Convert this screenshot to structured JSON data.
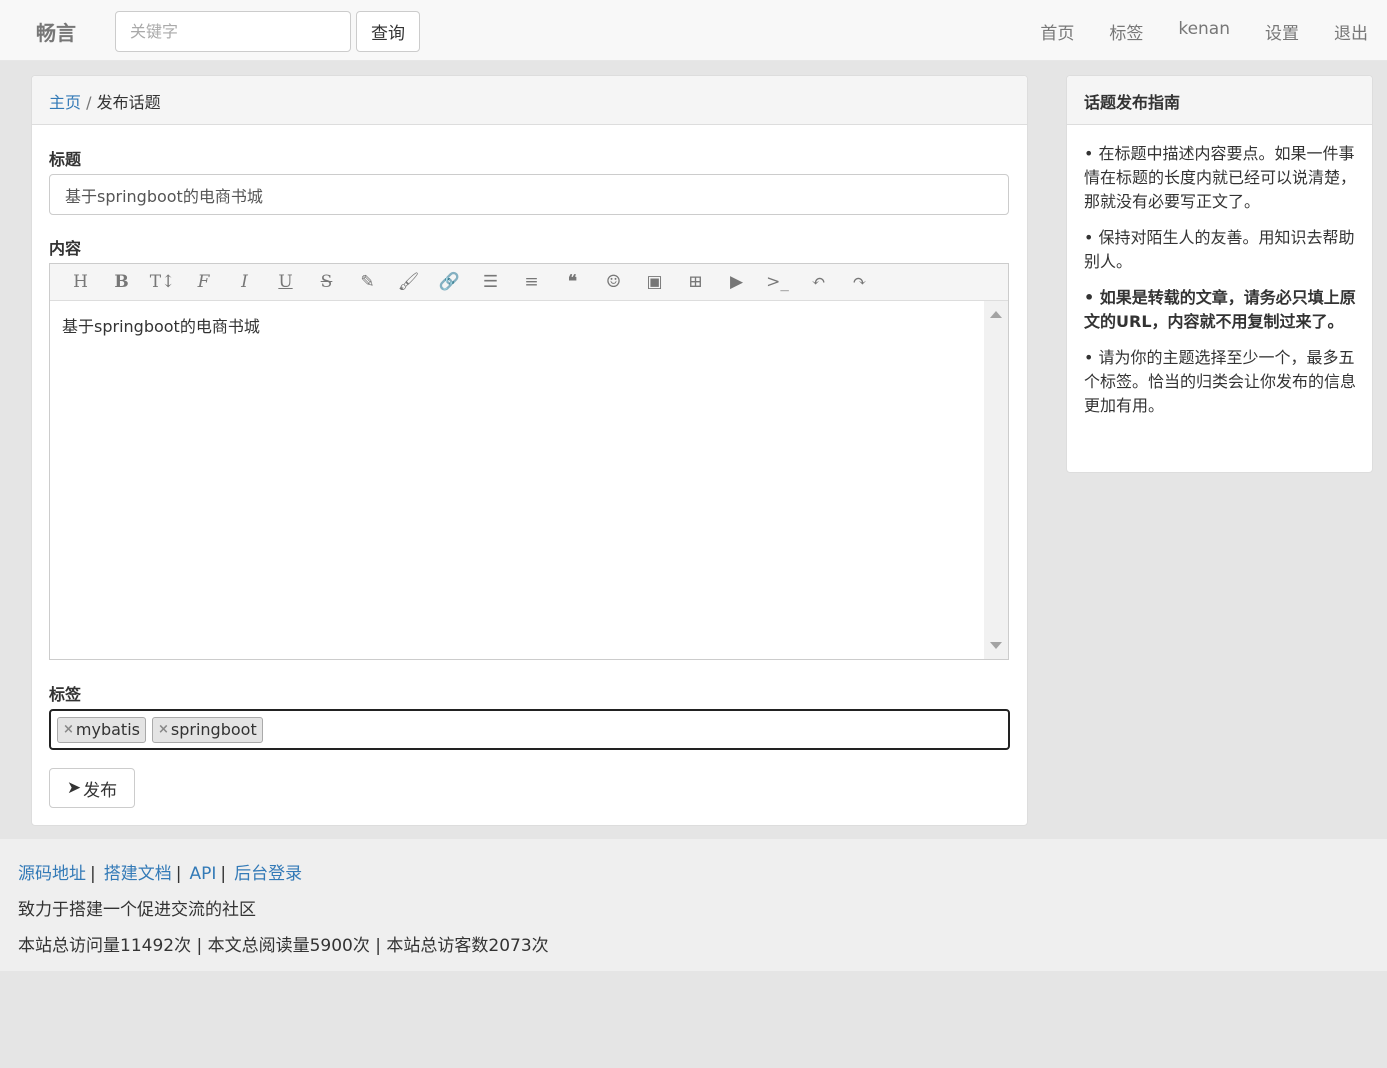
{
  "navbar": {
    "brand": "畅言",
    "search_placeholder": "关键字",
    "search_button": "查询",
    "links": [
      "首页",
      "标签",
      "kenan",
      "设置",
      "退出"
    ]
  },
  "breadcrumb": {
    "home": "主页",
    "separator": "/",
    "current": "发布话题"
  },
  "form": {
    "title_label": "标题",
    "title_value": "基于springboot的电商书城",
    "content_label": "内容",
    "content_value": "基于springboot的电商书城",
    "toolbar_icons": [
      "heading-icon",
      "bold-icon",
      "text-height-icon",
      "font-icon",
      "italic-icon",
      "underline-icon",
      "strikethrough-icon",
      "pencil-icon",
      "brush-icon",
      "link-icon",
      "list-icon",
      "align-left-icon",
      "quote-icon",
      "smile-icon",
      "image-icon",
      "table-icon",
      "video-icon",
      "terminal-icon",
      "undo-icon",
      "redo-icon"
    ],
    "tags_label": "标签",
    "tags": [
      "mybatis",
      "springboot"
    ],
    "publish_button": "发布"
  },
  "guide": {
    "title": "话题发布指南",
    "items": [
      "• 在标题中描述内容要点。如果一件事情在标题的长度内就已经可以说清楚，那就没有必要写正文了。",
      "• 保持对陌生人的友善。用知识去帮助别人。",
      "• 如果是转载的文章，请务必只填上原文的URL，内容就不用复制过来了。",
      "• 请为你的主题选择至少一个，最多五个标签。恰当的归类会让你发布的信息更加有用。"
    ]
  },
  "footer": {
    "links": [
      "源码地址",
      "搭建文档",
      "API",
      "后台登录"
    ],
    "separator": "|",
    "slogan": "致力于搭建一个促进交流的社区",
    "stats": "本站总访问量11492次 | 本文总阅读量5900次 | 本站总访客数2073次"
  }
}
